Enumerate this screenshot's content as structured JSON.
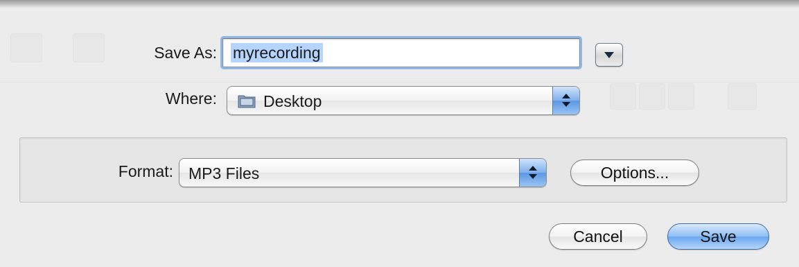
{
  "dialog": {
    "save_as_label": "Save As:",
    "filename_value": "myrecording",
    "where_label": "Where:",
    "where_value": "Desktop",
    "where_icon": "folder-icon",
    "format_label": "Format:",
    "format_value": "MP3 Files",
    "options_label": "Options...",
    "cancel_label": "Cancel",
    "save_label": "Save",
    "accent_color": "#6aa6ee"
  }
}
